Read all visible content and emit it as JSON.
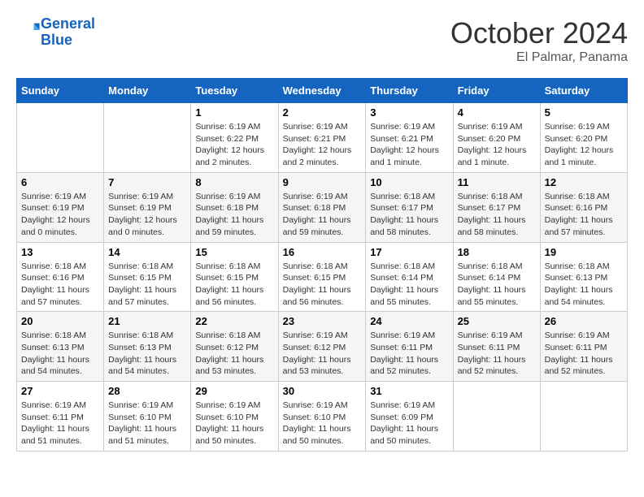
{
  "header": {
    "logo_line1": "General",
    "logo_line2": "Blue",
    "month": "October 2024",
    "location": "El Palmar, Panama"
  },
  "days_of_week": [
    "Sunday",
    "Monday",
    "Tuesday",
    "Wednesday",
    "Thursday",
    "Friday",
    "Saturday"
  ],
  "weeks": [
    [
      {
        "day": "",
        "info": ""
      },
      {
        "day": "",
        "info": ""
      },
      {
        "day": "1",
        "info": "Sunrise: 6:19 AM\nSunset: 6:22 PM\nDaylight: 12 hours and 2 minutes."
      },
      {
        "day": "2",
        "info": "Sunrise: 6:19 AM\nSunset: 6:21 PM\nDaylight: 12 hours and 2 minutes."
      },
      {
        "day": "3",
        "info": "Sunrise: 6:19 AM\nSunset: 6:21 PM\nDaylight: 12 hours and 1 minute."
      },
      {
        "day": "4",
        "info": "Sunrise: 6:19 AM\nSunset: 6:20 PM\nDaylight: 12 hours and 1 minute."
      },
      {
        "day": "5",
        "info": "Sunrise: 6:19 AM\nSunset: 6:20 PM\nDaylight: 12 hours and 1 minute."
      }
    ],
    [
      {
        "day": "6",
        "info": "Sunrise: 6:19 AM\nSunset: 6:19 PM\nDaylight: 12 hours and 0 minutes."
      },
      {
        "day": "7",
        "info": "Sunrise: 6:19 AM\nSunset: 6:19 PM\nDaylight: 12 hours and 0 minutes."
      },
      {
        "day": "8",
        "info": "Sunrise: 6:19 AM\nSunset: 6:18 PM\nDaylight: 11 hours and 59 minutes."
      },
      {
        "day": "9",
        "info": "Sunrise: 6:19 AM\nSunset: 6:18 PM\nDaylight: 11 hours and 59 minutes."
      },
      {
        "day": "10",
        "info": "Sunrise: 6:18 AM\nSunset: 6:17 PM\nDaylight: 11 hours and 58 minutes."
      },
      {
        "day": "11",
        "info": "Sunrise: 6:18 AM\nSunset: 6:17 PM\nDaylight: 11 hours and 58 minutes."
      },
      {
        "day": "12",
        "info": "Sunrise: 6:18 AM\nSunset: 6:16 PM\nDaylight: 11 hours and 57 minutes."
      }
    ],
    [
      {
        "day": "13",
        "info": "Sunrise: 6:18 AM\nSunset: 6:16 PM\nDaylight: 11 hours and 57 minutes."
      },
      {
        "day": "14",
        "info": "Sunrise: 6:18 AM\nSunset: 6:15 PM\nDaylight: 11 hours and 57 minutes."
      },
      {
        "day": "15",
        "info": "Sunrise: 6:18 AM\nSunset: 6:15 PM\nDaylight: 11 hours and 56 minutes."
      },
      {
        "day": "16",
        "info": "Sunrise: 6:18 AM\nSunset: 6:15 PM\nDaylight: 11 hours and 56 minutes."
      },
      {
        "day": "17",
        "info": "Sunrise: 6:18 AM\nSunset: 6:14 PM\nDaylight: 11 hours and 55 minutes."
      },
      {
        "day": "18",
        "info": "Sunrise: 6:18 AM\nSunset: 6:14 PM\nDaylight: 11 hours and 55 minutes."
      },
      {
        "day": "19",
        "info": "Sunrise: 6:18 AM\nSunset: 6:13 PM\nDaylight: 11 hours and 54 minutes."
      }
    ],
    [
      {
        "day": "20",
        "info": "Sunrise: 6:18 AM\nSunset: 6:13 PM\nDaylight: 11 hours and 54 minutes."
      },
      {
        "day": "21",
        "info": "Sunrise: 6:18 AM\nSunset: 6:13 PM\nDaylight: 11 hours and 54 minutes."
      },
      {
        "day": "22",
        "info": "Sunrise: 6:18 AM\nSunset: 6:12 PM\nDaylight: 11 hours and 53 minutes."
      },
      {
        "day": "23",
        "info": "Sunrise: 6:19 AM\nSunset: 6:12 PM\nDaylight: 11 hours and 53 minutes."
      },
      {
        "day": "24",
        "info": "Sunrise: 6:19 AM\nSunset: 6:11 PM\nDaylight: 11 hours and 52 minutes."
      },
      {
        "day": "25",
        "info": "Sunrise: 6:19 AM\nSunset: 6:11 PM\nDaylight: 11 hours and 52 minutes."
      },
      {
        "day": "26",
        "info": "Sunrise: 6:19 AM\nSunset: 6:11 PM\nDaylight: 11 hours and 52 minutes."
      }
    ],
    [
      {
        "day": "27",
        "info": "Sunrise: 6:19 AM\nSunset: 6:11 PM\nDaylight: 11 hours and 51 minutes."
      },
      {
        "day": "28",
        "info": "Sunrise: 6:19 AM\nSunset: 6:10 PM\nDaylight: 11 hours and 51 minutes."
      },
      {
        "day": "29",
        "info": "Sunrise: 6:19 AM\nSunset: 6:10 PM\nDaylight: 11 hours and 50 minutes."
      },
      {
        "day": "30",
        "info": "Sunrise: 6:19 AM\nSunset: 6:10 PM\nDaylight: 11 hours and 50 minutes."
      },
      {
        "day": "31",
        "info": "Sunrise: 6:19 AM\nSunset: 6:09 PM\nDaylight: 11 hours and 50 minutes."
      },
      {
        "day": "",
        "info": ""
      },
      {
        "day": "",
        "info": ""
      }
    ]
  ]
}
